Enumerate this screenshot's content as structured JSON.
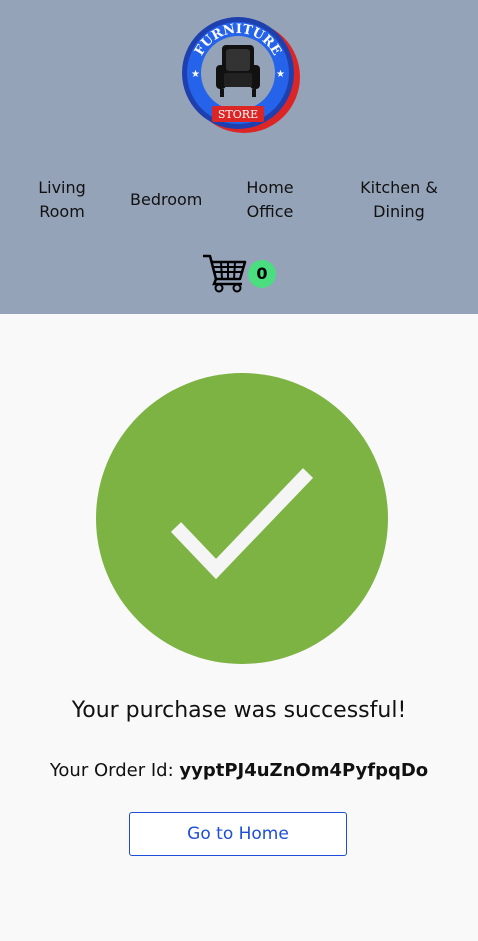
{
  "brand": {
    "logo_top_text": "FURNITURE",
    "logo_bottom_text": "STORE"
  },
  "nav": {
    "items": [
      {
        "line1": "Living",
        "line2": "Room"
      },
      {
        "line1": "Bedroom",
        "line2": ""
      },
      {
        "line1": "Home",
        "line2": "Office"
      },
      {
        "line1": "Kitchen &",
        "line2": "Dining"
      }
    ]
  },
  "cart": {
    "count": "0",
    "icon": "shopping-cart-icon"
  },
  "success": {
    "icon": "checkmark-circle-icon",
    "message": "Your purchase was successful!",
    "order_label": "Your Order Id: ",
    "order_id": "yyptPJ4uZnOm4PyfpqDo",
    "home_button": "Go to Home"
  },
  "colors": {
    "header_bg": "#94a3b8",
    "success_green": "#7cb342",
    "accent_blue": "#1d4ed8",
    "badge_green": "#4ade80"
  }
}
